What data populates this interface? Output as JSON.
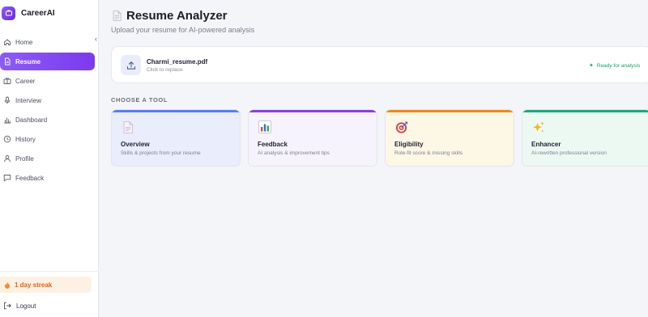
{
  "app": {
    "name": "CareerAI"
  },
  "sidebar": {
    "collapse_glyph": "‹",
    "items": [
      {
        "label": "Home",
        "icon": "home-icon",
        "active": false
      },
      {
        "label": "Resume",
        "icon": "document-icon",
        "active": true
      },
      {
        "label": "Career",
        "icon": "briefcase-icon",
        "active": false
      },
      {
        "label": "Interview",
        "icon": "microphone-icon",
        "active": false
      },
      {
        "label": "Dashboard",
        "icon": "bar-chart-icon",
        "active": false
      },
      {
        "label": "History",
        "icon": "clock-icon",
        "active": false
      },
      {
        "label": "Profile",
        "icon": "user-icon",
        "active": false
      },
      {
        "label": "Feedback",
        "icon": "message-icon",
        "active": false
      }
    ],
    "streak": {
      "label": "1 day streak",
      "icon": "fire-icon"
    },
    "logout": {
      "label": "Logout",
      "icon": "logout-icon"
    }
  },
  "page": {
    "title": "Resume Analyzer",
    "subtitle": "Upload your resume for AI-powered analysis"
  },
  "upload": {
    "file_name": "Charmi_resume.pdf",
    "hint": "Click to replace",
    "status": "Ready for analysis",
    "status_color": "#1e9e63"
  },
  "tools": {
    "section_label": "CHOOSE A TOOL",
    "cards": [
      {
        "title": "Overview",
        "desc": "Skills & projects from your resume",
        "icon": "document-icon",
        "accent": "#5b7cf0",
        "bg": "#eaedfb"
      },
      {
        "title": "Feedback",
        "desc": "AI analysis & improvement tips",
        "icon": "bar-chart-icon",
        "accent": "#8b3fd9",
        "bg": "#f6f3fd"
      },
      {
        "title": "Eligibility",
        "desc": "Role-fit score & missing skills",
        "icon": "target-icon",
        "accent": "#ec8a1c",
        "bg": "#fdf7e6"
      },
      {
        "title": "Enhancer",
        "desc": "AI-rewritten professional version",
        "icon": "sparkles-icon",
        "accent": "#1ba97a",
        "bg": "#ecf9f3"
      }
    ]
  },
  "colors": {
    "accent": "#7c3aed",
    "page_bg": "#f4f5f8"
  }
}
